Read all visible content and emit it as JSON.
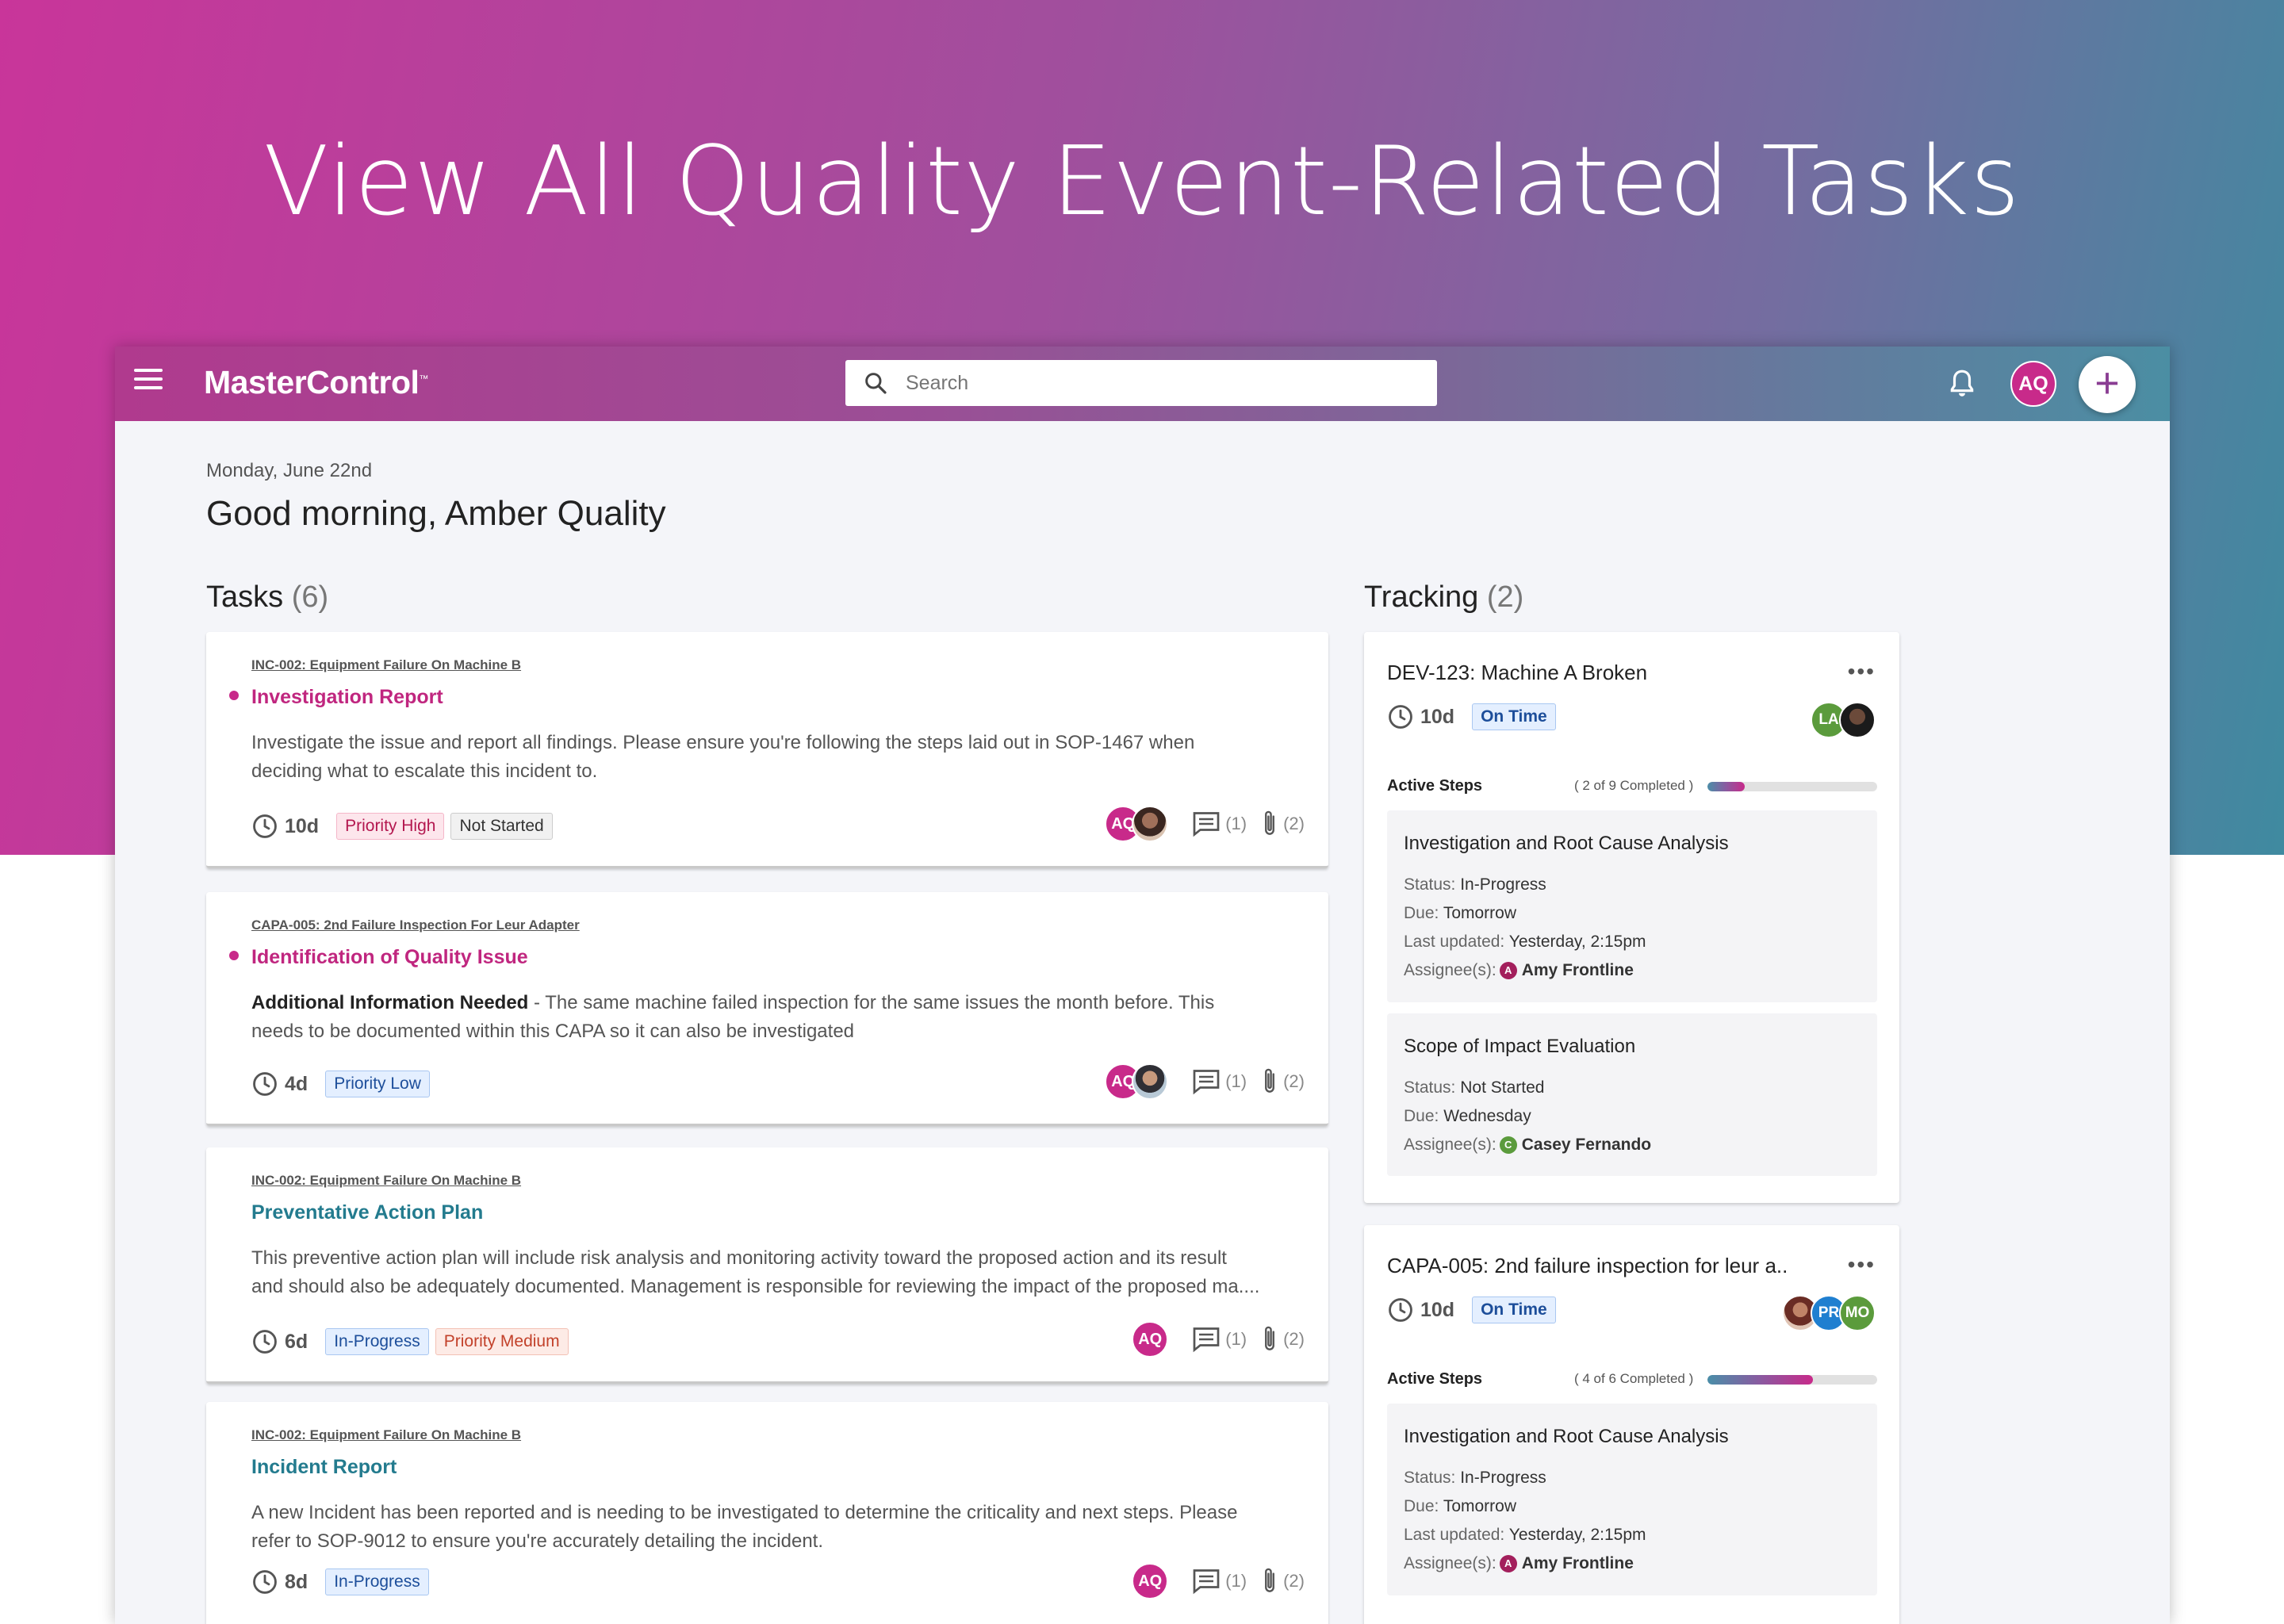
{
  "hero": {
    "title": "View All Quality Event-Related Tasks"
  },
  "topbar": {
    "logo": "MasterControl",
    "logo_mark": "™",
    "search_placeholder": "Search",
    "user_initials": "AQ",
    "add_label": "+"
  },
  "greeting": {
    "date": "Monday, June 22nd",
    "text": "Good morning, Amber Quality"
  },
  "tasks": {
    "title": "Tasks",
    "count": "(6)",
    "items": [
      {
        "ref": "INC-002: Equipment Failure On Machine B",
        "title": "Investigation Report",
        "desc_line1": "Investigate the issue and report all findings. Please ensure you're following the steps laid out in SOP-1467 when",
        "desc_line2": "deciding what to escalate this incident to.",
        "days": "10d",
        "tags": [
          "Priority High",
          "Not Started"
        ],
        "avatar": "AQ",
        "comments": "(1)",
        "attachments": "(2)"
      },
      {
        "ref": "CAPA-005: 2nd Failure Inspection For Leur Adapter",
        "title": "Identification of Quality Issue",
        "desc_bold": "Additional Information Needed",
        "desc_line1": " - The same machine failed inspection for the same issues the month before. This",
        "desc_line2": "needs to be documented within this CAPA so it can also be investigated",
        "days": "4d",
        "tags": [
          "Priority Low"
        ],
        "avatar": "AQ",
        "comments": "(1)",
        "attachments": "(2)"
      },
      {
        "ref": "INC-002: Equipment Failure On Machine B",
        "title": "Preventative Action Plan",
        "desc_line1": "This preventive action plan will include risk analysis and monitoring activity toward the proposed action and its result",
        "desc_line2": "and should also be adequately documented. Management is responsible for reviewing the impact of the proposed ma....",
        "days": "6d",
        "tags": [
          "In-Progress",
          "Priority Medium"
        ],
        "avatar": "AQ",
        "comments": "(1)",
        "attachments": "(2)"
      },
      {
        "ref": "INC-002: Equipment Failure On Machine B",
        "title": "Incident Report",
        "desc_line1": "A new Incident has been reported and is needing to be investigated to determine the criticality and next steps. Please",
        "desc_line2": "refer to SOP-9012 to ensure you're accurately detailing the incident.",
        "days": "8d",
        "tags": [
          "In-Progress"
        ],
        "avatar": "AQ",
        "comments": "(1)",
        "attachments": "(2)"
      }
    ]
  },
  "tracking": {
    "title": "Tracking",
    "count": "(2)",
    "items": [
      {
        "title": "DEV-123: Machine A Broken",
        "more": "•••",
        "days": "10d",
        "status": "On Time",
        "avatars": [
          "LA"
        ],
        "steps_label": "Active Steps",
        "steps_count": "( 2 of 9 Completed )",
        "progress": 0.22,
        "steps": [
          {
            "title": "Investigation and Root Cause Analysis",
            "status_label": "Status:",
            "status": "In-Progress",
            "due_label": "Due:",
            "due": "Tomorrow",
            "updated_label": "Last updated:",
            "updated": "Yesterday, 2:15pm",
            "assignee_label": "Assignee(s):",
            "assignee_initial": "A",
            "assignee": "Amy Frontline"
          },
          {
            "title": "Scope of Impact Evaluation",
            "status_label": "Status:",
            "status": "Not Started",
            "due_label": "Due:",
            "due": "Wednesday",
            "assignee_label": "Assignee(s):",
            "assignee_initial": "C",
            "assignee": "Casey Fernando"
          }
        ]
      },
      {
        "title": "CAPA-005: 2nd failure inspection for leur a..",
        "more": "•••",
        "days": "10d",
        "status": "On Time",
        "avatars": [
          "PR",
          "MO"
        ],
        "steps_label": "Active Steps",
        "steps_count": "( 4 of 6 Completed )",
        "progress": 0.62,
        "steps": [
          {
            "title": "Investigation and Root Cause Analysis",
            "status_label": "Status:",
            "status": "In-Progress",
            "due_label": "Due:",
            "due": "Tomorrow",
            "updated_label": "Last updated:",
            "updated": "Yesterday, 2:15pm",
            "assignee_label": "Assignee(s):",
            "assignee_initial": "A",
            "assignee": "Amy Frontline"
          }
        ]
      }
    ]
  },
  "colors": {
    "accent_pink": "#c82a8a",
    "accent_teal": "#237b8e"
  }
}
